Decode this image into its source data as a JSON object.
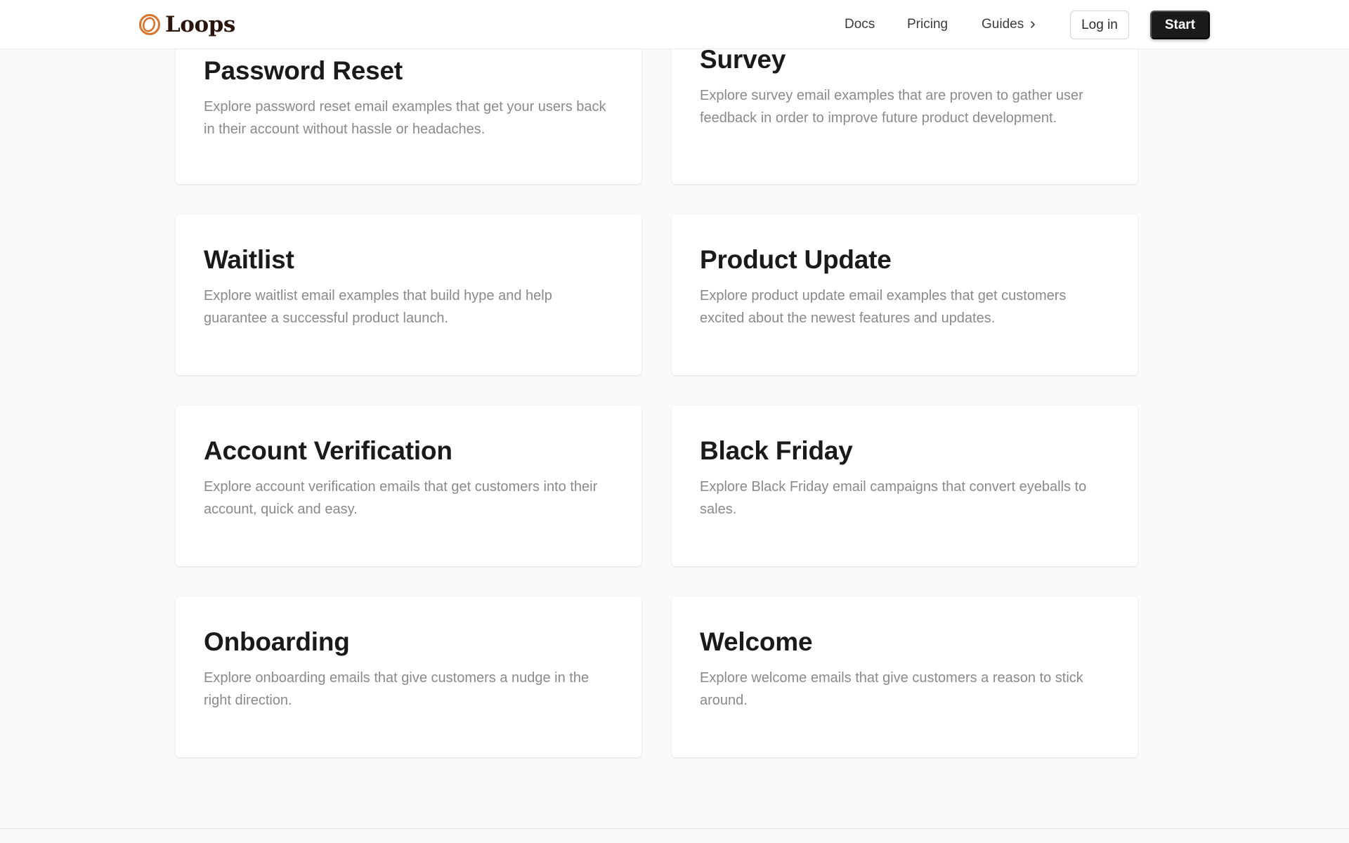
{
  "header": {
    "logo_text": "Loops",
    "nav": {
      "docs": "Docs",
      "pricing": "Pricing",
      "guides": "Guides"
    },
    "login_label": "Log in",
    "start_label": "Start"
  },
  "cards": [
    {
      "title": "Password Reset",
      "description": "Explore password reset email examples that get your users back in their account without hassle or headaches."
    },
    {
      "title": "Survey",
      "description": "Explore survey email examples that are proven to gather user feedback in order to improve future product development."
    },
    {
      "title": "Waitlist",
      "description": "Explore waitlist email examples that build hype and help guarantee a successful product launch."
    },
    {
      "title": "Product Update",
      "description": "Explore product update email examples that get customers excited about the newest features and updates."
    },
    {
      "title": "Account Verification",
      "description": "Explore account verification emails that get customers into their account, quick and easy."
    },
    {
      "title": "Black Friday",
      "description": "Explore Black Friday email campaigns that convert eyeballs to sales."
    },
    {
      "title": "Onboarding",
      "description": "Explore onboarding emails that give customers a nudge in the right direction."
    },
    {
      "title": "Welcome",
      "description": "Explore welcome emails that give customers a reason to stick around."
    }
  ],
  "icons": {
    "logo": "loops-logo-icon",
    "guides_chevron": "chevron-right-icon"
  },
  "colors": {
    "brand_orange": "#d9742f",
    "logo_text": "#2a160c",
    "page_background": "#f9fafb",
    "start_button": "#1b1b1b",
    "description_text": "#8a8a8a"
  }
}
